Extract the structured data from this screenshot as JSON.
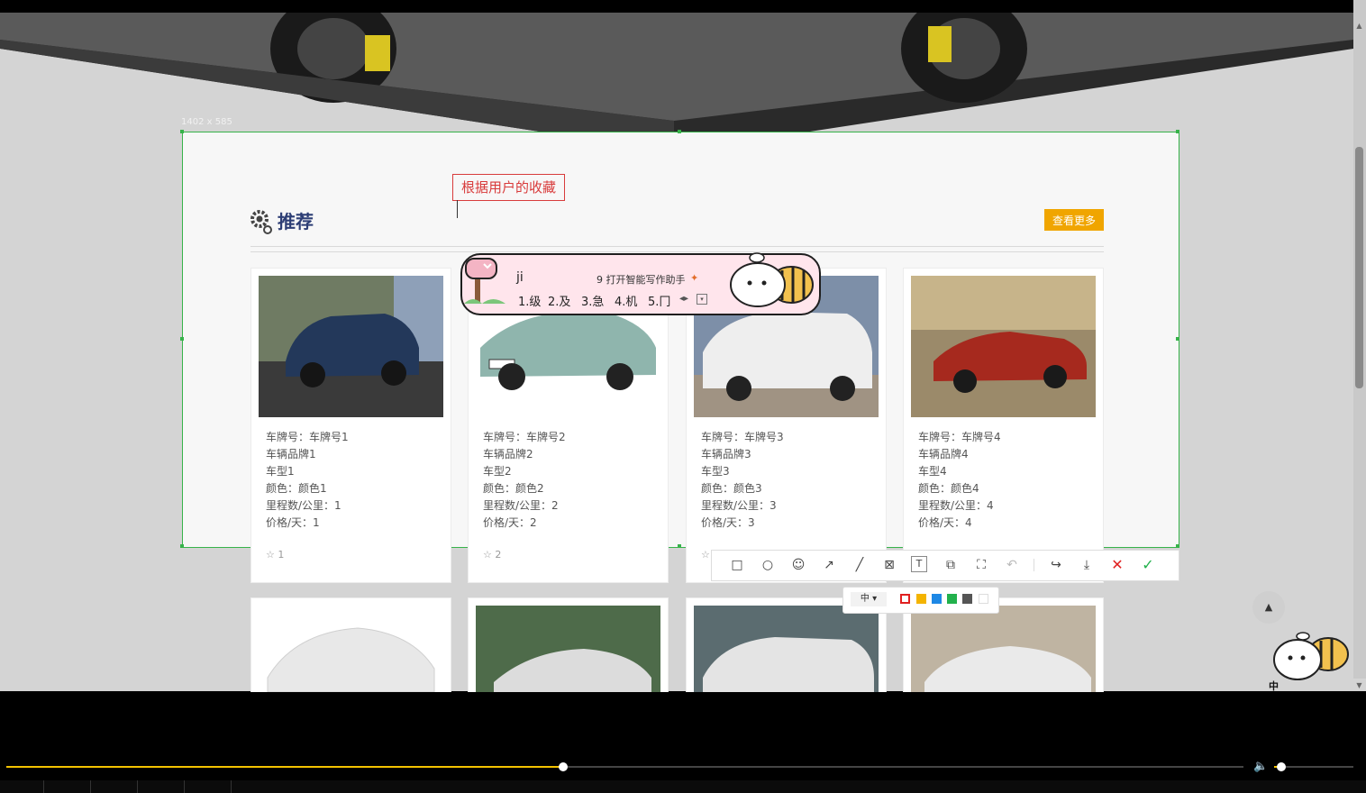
{
  "annotation": {
    "size_label": "1402 x 585",
    "text": "根据用户的收藏"
  },
  "section": {
    "title": "推荐",
    "more_button": "查看更多"
  },
  "cars": [
    {
      "plate": "车牌号：车牌号1",
      "brand": "车辆品牌1",
      "model": "车型1",
      "color": "颜色：颜色1",
      "mileage": "里程数/公里：1",
      "price": "价格/天：1",
      "favorites": "1"
    },
    {
      "plate": "车牌号：车牌号2",
      "brand": "车辆品牌2",
      "model": "车型2",
      "color": "颜色：颜色2",
      "mileage": "里程数/公里：2",
      "price": "价格/天：2",
      "favorites": "2"
    },
    {
      "plate": "车牌号：车牌号3",
      "brand": "车辆品牌3",
      "model": "车型3",
      "color": "颜色：颜色3",
      "mileage": "里程数/公里：3",
      "price": "价格/天：3",
      "favorites": ""
    },
    {
      "plate": "车牌号：车牌号4",
      "brand": "车辆品牌4",
      "model": "车型4",
      "color": "颜色：颜色4",
      "mileage": "里程数/公里：4",
      "price": "价格/天：4",
      "favorites": ""
    }
  ],
  "ime": {
    "input": "ji",
    "assist": "9 打开智能写作助手",
    "candidates": [
      "1.级",
      "2.及",
      "3.急",
      "4.机",
      "5.冂"
    ]
  },
  "toolbar": {
    "tools": [
      "rectangle-icon",
      "ellipse-icon",
      "emoji-icon",
      "arrow-icon",
      "pen-icon",
      "mosaic-icon",
      "text-icon",
      "layers-icon",
      "ocr-icon",
      "undo-icon",
      "share-icon",
      "save-icon",
      "close-icon",
      "confirm-icon"
    ],
    "size_option": "中",
    "colors": [
      "#e02020",
      "#f4b400",
      "#1e88e5",
      "#22b14c",
      "#555555",
      "#ffffff"
    ]
  },
  "ime_indicator": "中",
  "player": {
    "progress": 0.45,
    "volume": 0.09
  },
  "colors": {
    "accent": "#f0a500",
    "title": "#2d3e75",
    "annotation": "#d83b3b",
    "selection": "#37b34a"
  }
}
